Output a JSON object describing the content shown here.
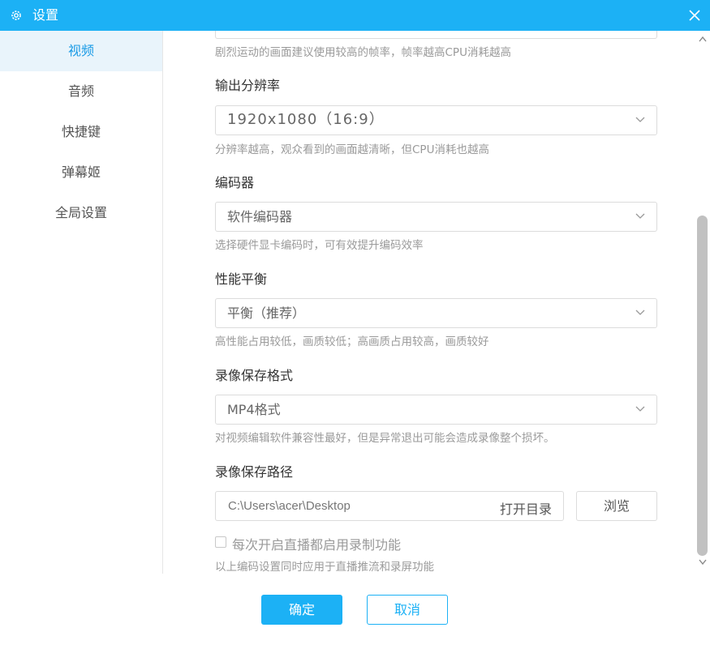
{
  "window": {
    "title": "设置",
    "accent": "#1cb1f5"
  },
  "sidebar": {
    "items": [
      {
        "label": "视频",
        "active": true
      },
      {
        "label": "音频"
      },
      {
        "label": "快捷键"
      },
      {
        "label": "弹幕姬"
      },
      {
        "label": "全局设置"
      }
    ]
  },
  "framerate": {
    "hint": "剧烈运动的画面建议使用较高的帧率，帧率越高CPU消耗越高"
  },
  "resolution": {
    "label": "输出分辨率",
    "value": "1920x1080（16:9）",
    "hint": "分辨率越高，观众看到的画面越清晰，但CPU消耗也越高"
  },
  "encoder": {
    "label": "编码器",
    "value": "软件编码器",
    "hint": "选择硬件显卡编码时，可有效提升编码效率"
  },
  "performance": {
    "label": "性能平衡",
    "value": "平衡（推荐）",
    "hint": "高性能占用较低，画质较低；高画质占用较高，画质较好"
  },
  "format": {
    "label": "录像保存格式",
    "value": "MP4格式",
    "hint": "对视频编辑软件兼容性最好，但是异常退出可能会造成录像整个损坏。"
  },
  "save_path": {
    "label": "录像保存路径",
    "value": "C:\\Users\\acer\\Desktop",
    "open_dir": "打开目录",
    "browse": "浏览"
  },
  "auto_record": {
    "label": "每次开启直播都启用录制功能",
    "checked": false
  },
  "footer_note": "以上编码设置同时应用于直播推流和录屏功能",
  "buttons": {
    "ok": "确定",
    "cancel": "取消"
  }
}
